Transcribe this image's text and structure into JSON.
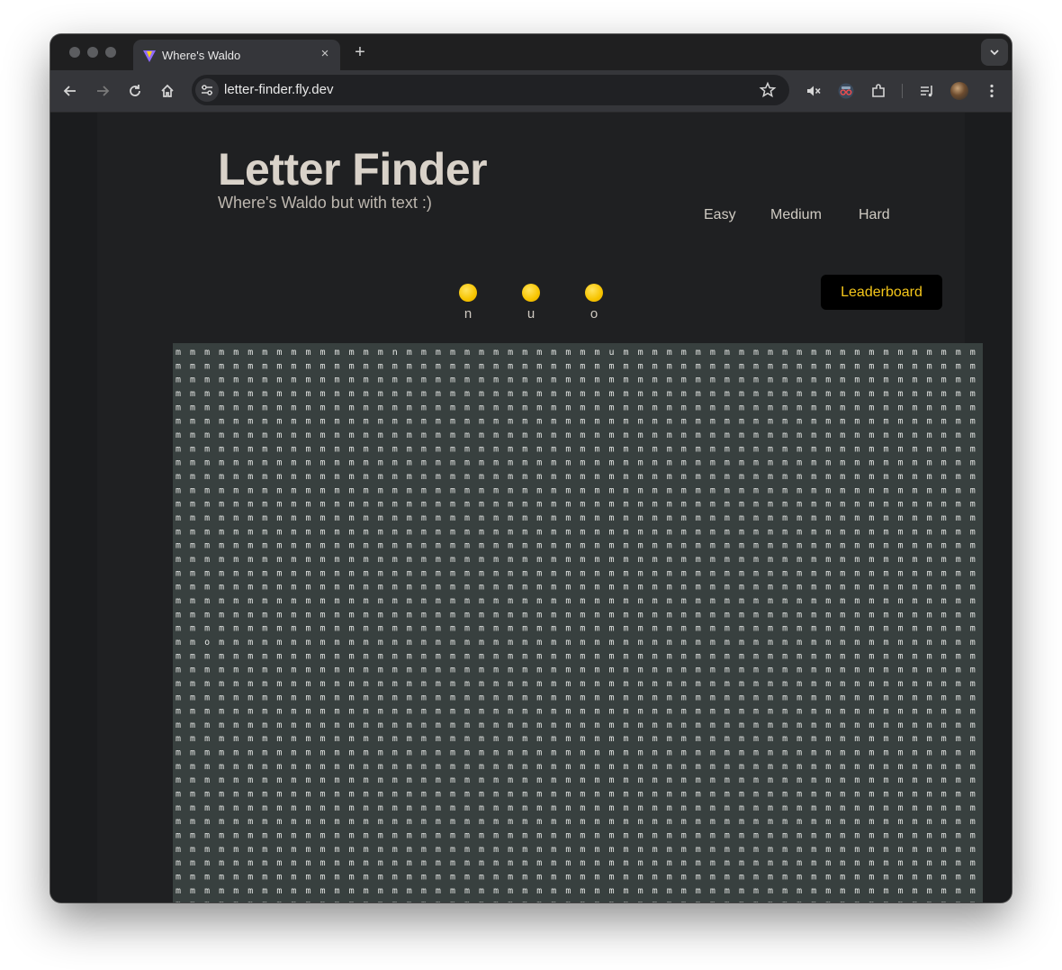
{
  "browser": {
    "tab_title": "Where's Waldo",
    "new_tab": "+",
    "close_tab": "×",
    "url": "letter-finder.fly.dev"
  },
  "page": {
    "title": "Letter Finder",
    "subtitle": "Where's Waldo but with text :)",
    "difficulty": [
      "Easy",
      "Medium",
      "Hard"
    ],
    "leaderboard_label": "Leaderboard",
    "accent_color": "#f5c71a"
  },
  "targets": [
    {
      "letter": "n"
    },
    {
      "letter": "u"
    },
    {
      "letter": "o"
    }
  ],
  "grid": {
    "filler_letter": "m",
    "visible_rows": 43,
    "columns": 57,
    "odd_letters": [
      {
        "row": 1,
        "col": 16,
        "letter": "n"
      },
      {
        "row": 1,
        "col": 31,
        "letter": "u"
      },
      {
        "row": 22,
        "col": 3,
        "letter": "o"
      }
    ]
  }
}
